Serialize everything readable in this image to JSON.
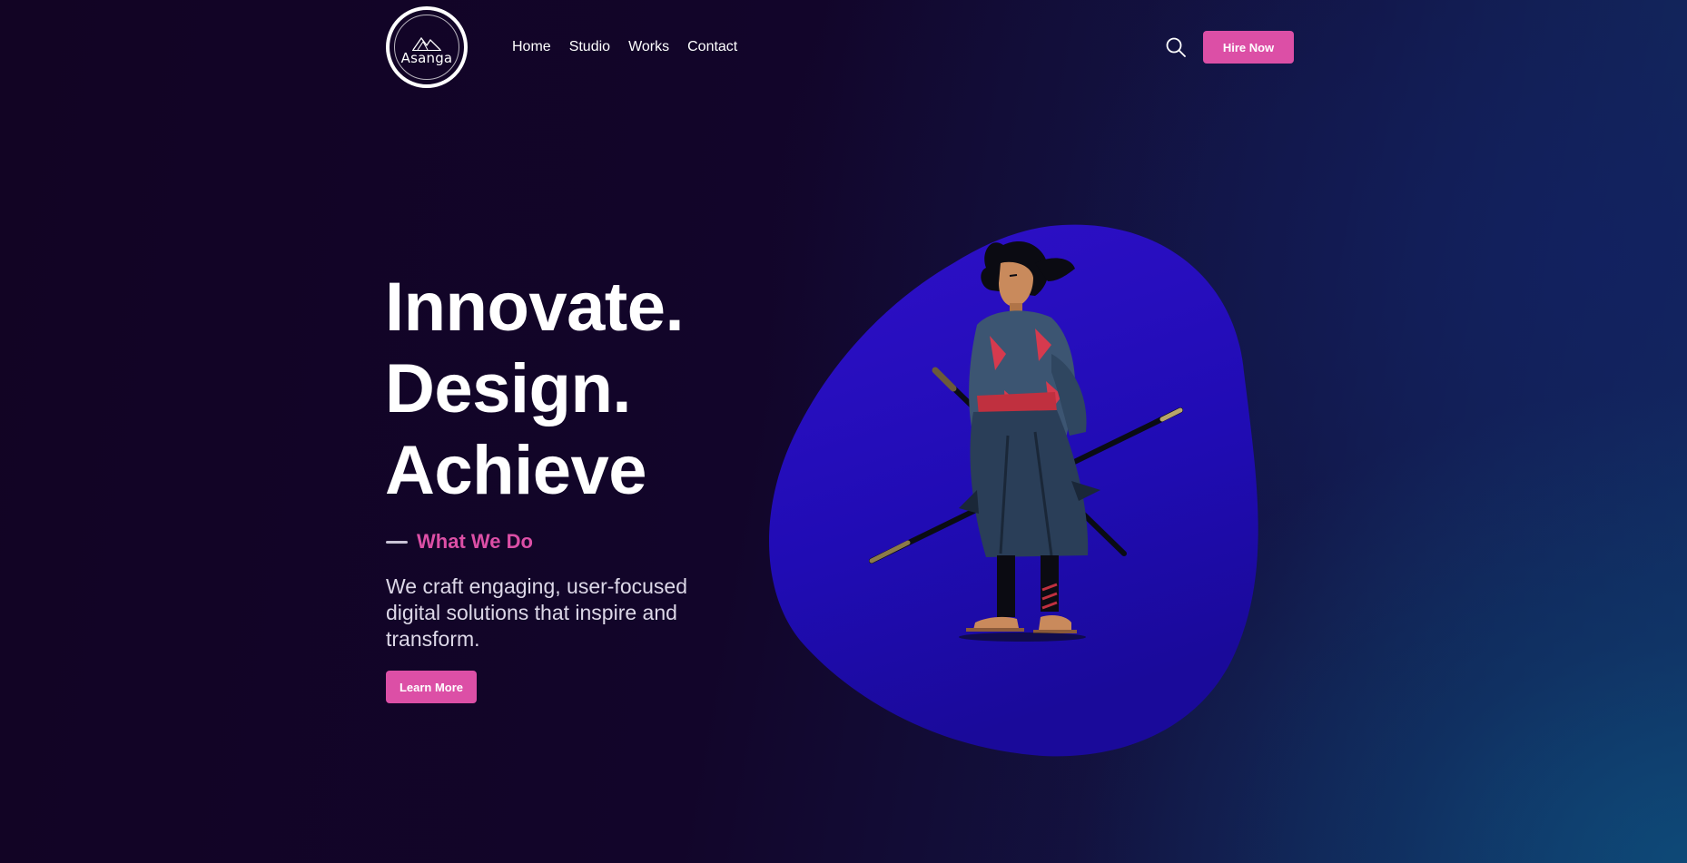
{
  "header": {
    "logo_text": "Asanga",
    "nav": [
      {
        "label": "Home"
      },
      {
        "label": "Studio"
      },
      {
        "label": "Works"
      },
      {
        "label": "Contact"
      }
    ],
    "search_icon": "search-icon",
    "cta_label": "Hire Now"
  },
  "hero": {
    "title_lines": [
      "Innovate.",
      "Design.",
      "Achieve"
    ],
    "eyebrow": "What We Do",
    "description": "We craft engaging, user-focused digital solutions that inspire and transform.",
    "button_label": "Learn More",
    "illustration": "samurai-illustration"
  },
  "colors": {
    "accent": "#dc4fa6",
    "background_dark": "#120424",
    "background_blue": "#0e4a78",
    "blob": "#2a0fc8"
  }
}
